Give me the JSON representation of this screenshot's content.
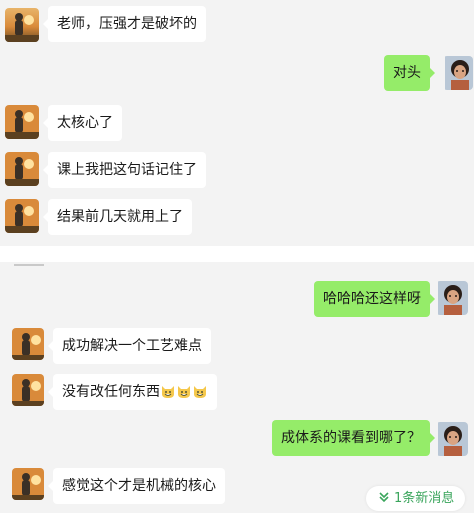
{
  "messages": [
    {
      "side": "in",
      "text": "老师，压强才是破坏的"
    },
    {
      "side": "out",
      "text": "对头"
    },
    {
      "side": "in",
      "text": "太核心了"
    },
    {
      "side": "in",
      "text": "课上我把这句话记住了"
    },
    {
      "side": "in",
      "text": "结果前几天就用上了"
    },
    {
      "side": "out",
      "text": "哈哈哈还这样呀"
    },
    {
      "side": "in",
      "text": "成功解决一个工艺难点"
    },
    {
      "side": "in",
      "text": "没有改任何东西"
    },
    {
      "side": "out",
      "text": "成体系的课看到哪了？"
    },
    {
      "side": "in",
      "text": "感觉这个才是机械的核心"
    }
  ],
  "emoji": {
    "name": "grinning-cat-emoji",
    "count": 3
  },
  "new_message_pill": {
    "label": "1条新消息",
    "icon": "double-chevron-down-icon"
  },
  "colors": {
    "background": "#f3f3f3",
    "incoming_bubble": "#ffffff",
    "outgoing_bubble": "#95ec69",
    "accent_green": "#3aa55c"
  }
}
